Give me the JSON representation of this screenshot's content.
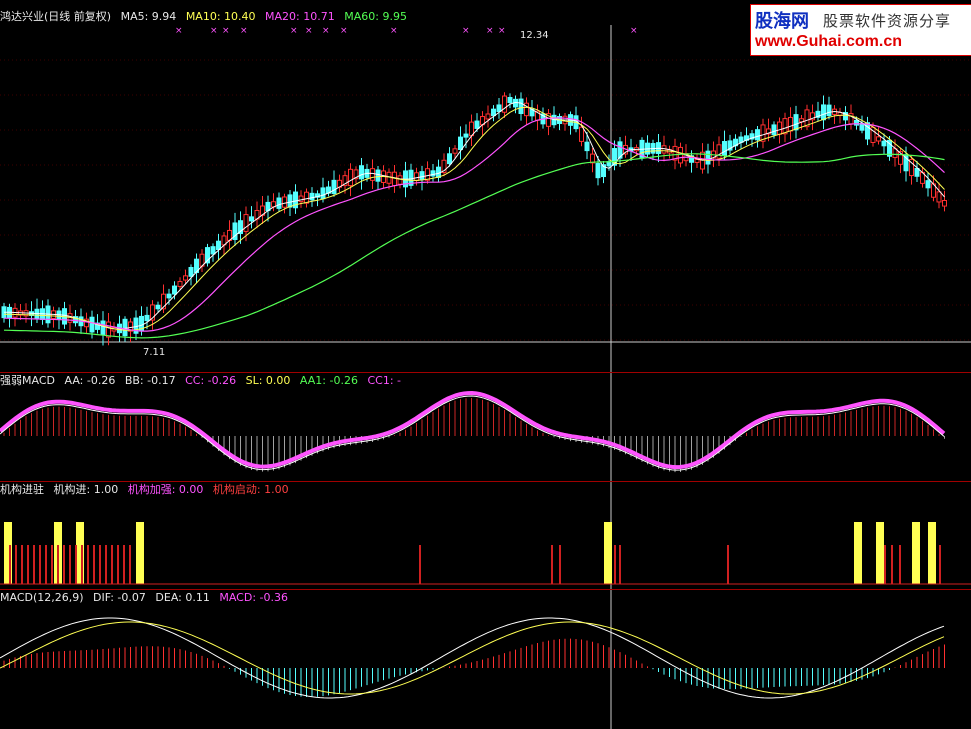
{
  "main_header": {
    "title": "鸿达兴业(日线 前复权)",
    "ma5": "MA5: 9.94",
    "ma10": "MA10: 10.40",
    "ma20": "MA20: 10.71",
    "ma60": "MA60: 9.95"
  },
  "price_labels": {
    "high": "12.34",
    "low": "7.11"
  },
  "macd1_header": {
    "name": "强弱MACD",
    "aa": "AA: -0.26",
    "bb": "BB: -0.17",
    "cc": "CC: -0.26",
    "sl": "SL: 0.00",
    "aa1": "AA1: -0.26",
    "cc1": "CC1: -"
  },
  "inst_header": {
    "name": "机构进驻",
    "jgj": "机构进: 1.00",
    "jgjq": "机构加强: 0.00",
    "jgqd": "机构启动: 1.00"
  },
  "macd2_header": {
    "name": "MACD(12,26,9)",
    "dif": "DIF: -0.07",
    "dea": "DEA: 0.11",
    "macd": "MACD: -0.36"
  },
  "watermark": {
    "brand": "股海网",
    "slogan": "股票软件资源分享",
    "url": "www.Guhai.com.cn"
  },
  "colors": {
    "up": "#ff3030",
    "down": "#54ffff",
    "ma5": "#ffffff",
    "ma10": "#ffff54",
    "ma20": "#ff54ff",
    "ma60": "#54ff54",
    "frame": "#a00000"
  }
}
